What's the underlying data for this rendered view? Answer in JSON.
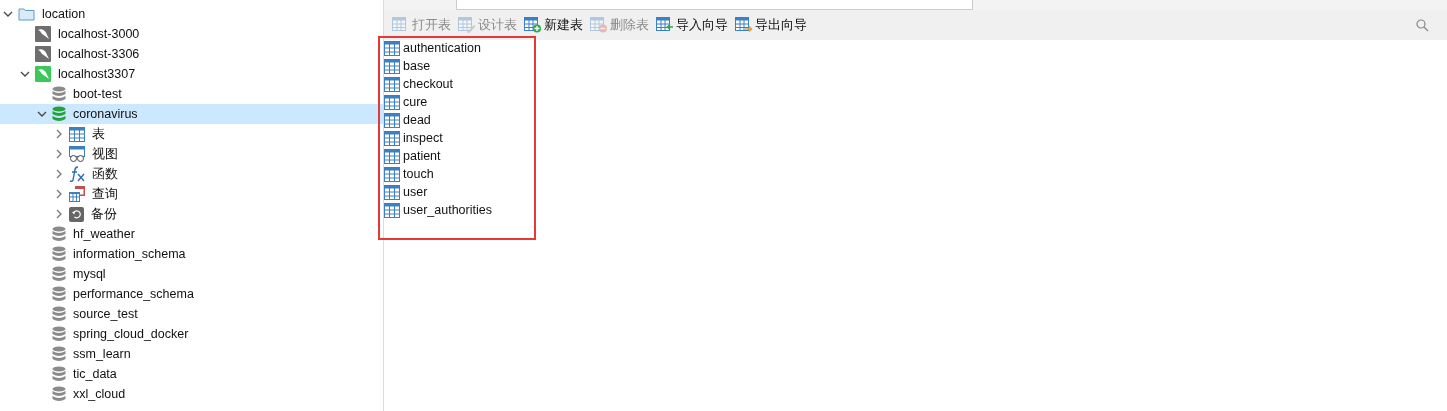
{
  "tree": [
    {
      "label": "location",
      "kind": "folder",
      "expanded": true,
      "selected": false,
      "children": [
        {
          "label": "localhost-3000",
          "kind": "server",
          "connected": false,
          "selected": false
        },
        {
          "label": "localhost-3306",
          "kind": "server",
          "connected": false,
          "selected": false
        },
        {
          "label": "localhost3307",
          "kind": "server",
          "connected": true,
          "expanded": true,
          "selected": false,
          "children": [
            {
              "label": "boot-test",
              "kind": "database",
              "connected": false,
              "selected": false
            },
            {
              "label": "coronavirus",
              "kind": "database",
              "connected": true,
              "expanded": true,
              "selected": true,
              "children": [
                {
                  "label": "表",
                  "kind": "tables",
                  "expanded": false,
                  "selected": false
                },
                {
                  "label": "视图",
                  "kind": "views",
                  "expanded": false,
                  "selected": false
                },
                {
                  "label": "函数",
                  "kind": "functions",
                  "expanded": false,
                  "selected": false
                },
                {
                  "label": "查询",
                  "kind": "queries",
                  "expanded": false,
                  "selected": false
                },
                {
                  "label": "备份",
                  "kind": "backups",
                  "expanded": false,
                  "selected": false
                }
              ]
            },
            {
              "label": "hf_weather",
              "kind": "database",
              "connected": false,
              "selected": false
            },
            {
              "label": "information_schema",
              "kind": "database",
              "connected": false,
              "selected": false
            },
            {
              "label": "mysql",
              "kind": "database",
              "connected": false,
              "selected": false
            },
            {
              "label": "performance_schema",
              "kind": "database",
              "connected": false,
              "selected": false
            },
            {
              "label": "source_test",
              "kind": "database",
              "connected": false,
              "selected": false
            },
            {
              "label": "spring_cloud_docker",
              "kind": "database",
              "connected": false,
              "selected": false
            },
            {
              "label": "ssm_learn",
              "kind": "database",
              "connected": false,
              "selected": false
            },
            {
              "label": "tic_data",
              "kind": "database",
              "connected": false,
              "selected": false
            },
            {
              "label": "xxl_cloud",
              "kind": "database",
              "connected": false,
              "selected": false
            }
          ]
        }
      ]
    }
  ],
  "toolbar": [
    {
      "label": "打开表",
      "kind": "open",
      "disabled": true
    },
    {
      "label": "设计表",
      "kind": "design",
      "disabled": true
    },
    {
      "label": "新建表",
      "kind": "new",
      "disabled": false
    },
    {
      "label": "删除表",
      "kind": "delete",
      "disabled": true
    },
    {
      "label": "导入向导",
      "kind": "import",
      "disabled": false
    },
    {
      "label": "导出向导",
      "kind": "export",
      "disabled": false
    }
  ],
  "tables": [
    "authentication",
    "base",
    "checkout",
    "cure",
    "dead",
    "inspect",
    "patient",
    "touch",
    "user",
    "user_authorities"
  ]
}
